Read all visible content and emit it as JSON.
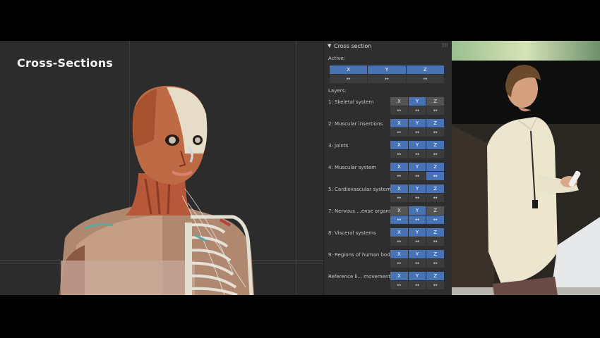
{
  "viewport": {
    "title": "Cross-Sections"
  },
  "panel": {
    "header": "Cross section",
    "active_label": "Active:",
    "axes": [
      "X",
      "Y",
      "Z"
    ],
    "arrow": "↔",
    "active_axes_on": [
      true,
      true,
      true
    ],
    "layers_label": "Layers:",
    "layers": [
      {
        "name": "1: Skeletal system",
        "axes_on": [
          false,
          true,
          false
        ],
        "arrows_on": [
          false,
          false,
          false
        ]
      },
      {
        "name": "2: Muscular insertions",
        "axes_on": [
          true,
          true,
          true
        ],
        "arrows_on": [
          false,
          false,
          false
        ]
      },
      {
        "name": "3: Joints",
        "axes_on": [
          true,
          true,
          true
        ],
        "arrows_on": [
          false,
          false,
          false
        ]
      },
      {
        "name": "4: Muscular system",
        "axes_on": [
          true,
          true,
          true
        ],
        "arrows_on": [
          false,
          false,
          true
        ]
      },
      {
        "name": "5: Cardiovascular system",
        "axes_on": [
          true,
          true,
          true
        ],
        "arrows_on": [
          false,
          false,
          false
        ]
      },
      {
        "name": "7: Nervous ...ense organs",
        "axes_on": [
          false,
          true,
          false
        ],
        "arrows_on": [
          true,
          true,
          true
        ]
      },
      {
        "name": "8: Visceral systems",
        "axes_on": [
          true,
          true,
          true
        ],
        "arrows_on": [
          false,
          false,
          false
        ]
      },
      {
        "name": "9: Regions of human bod",
        "axes_on": [
          true,
          true,
          true
        ],
        "arrows_on": [
          false,
          false,
          false
        ]
      },
      {
        "name": "Reference li... movements",
        "axes_on": [
          true,
          true,
          true
        ],
        "arrows_on": [
          false,
          false,
          false
        ]
      }
    ]
  },
  "colors": {
    "accent": "#4772b3",
    "panel_bg": "#2e2e2e",
    "viewport_bg": "#2b2c2b"
  }
}
